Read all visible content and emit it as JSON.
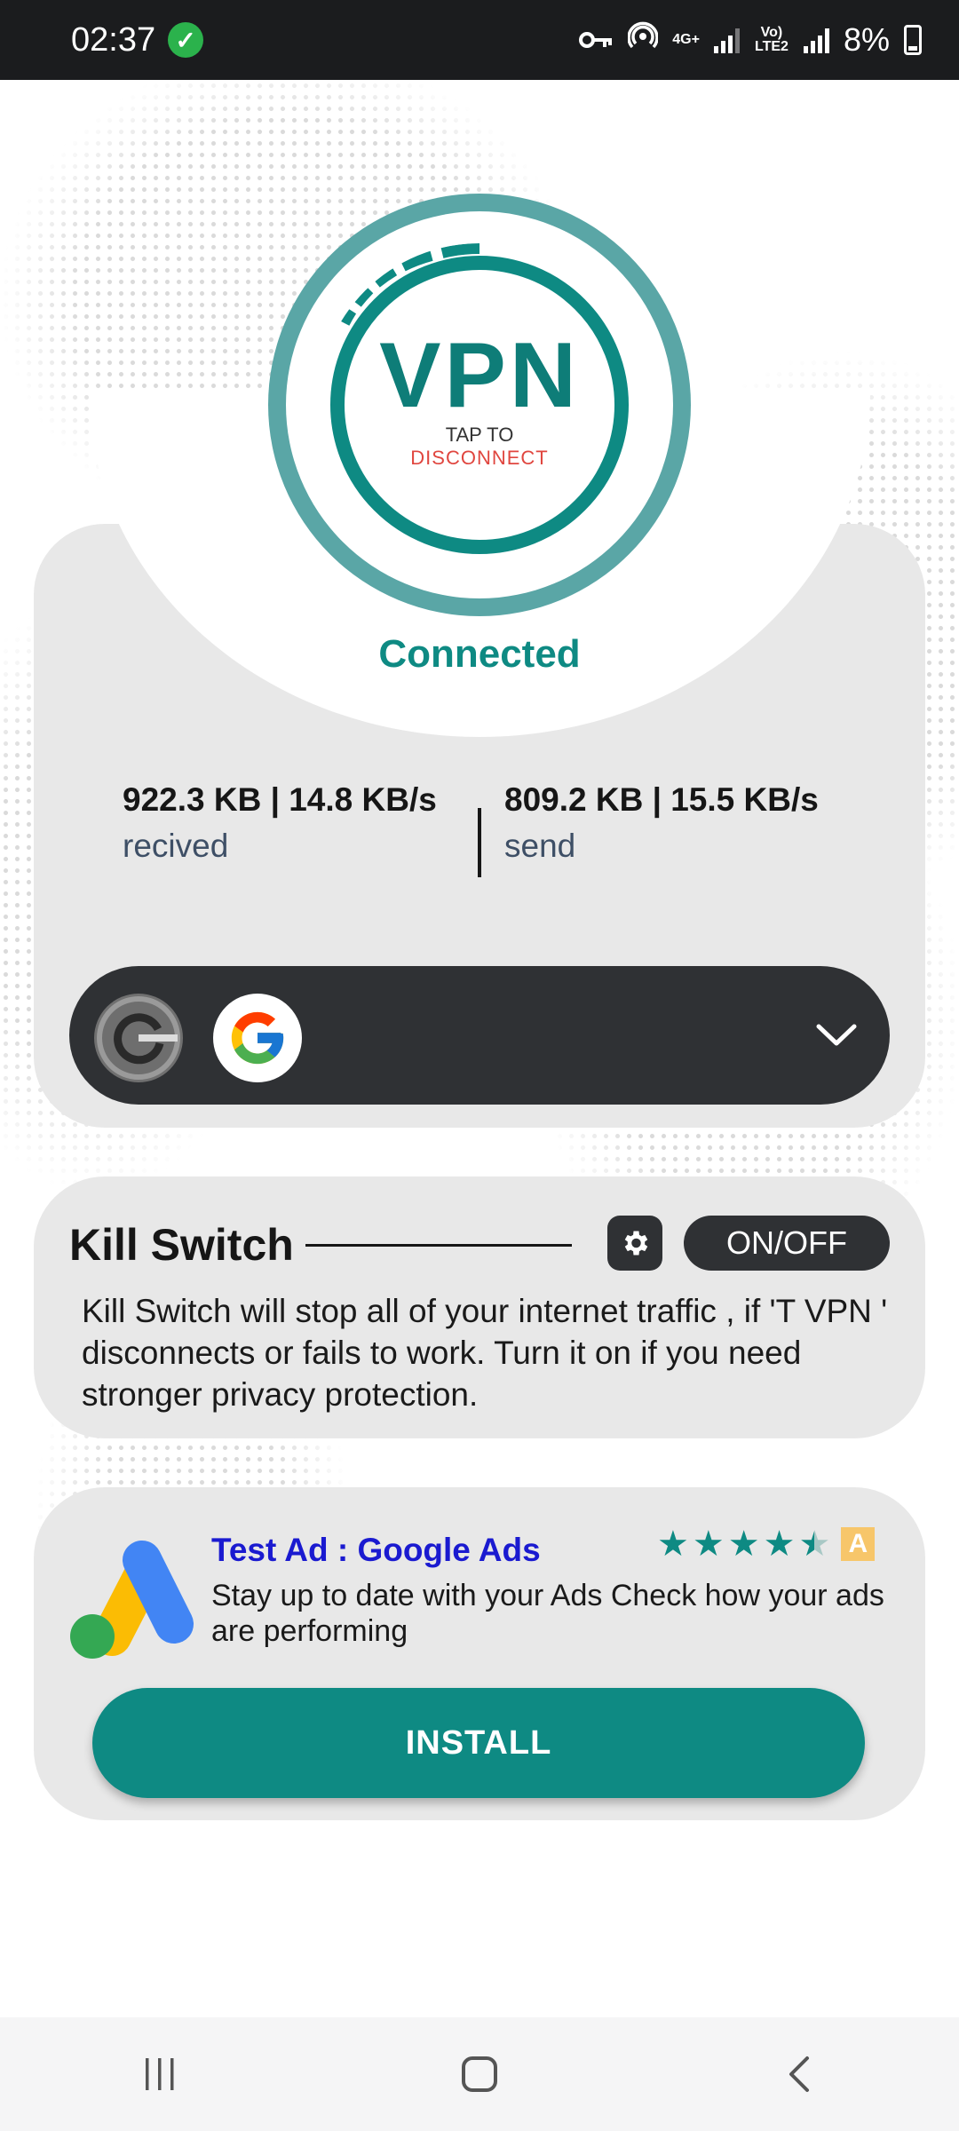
{
  "status_bar": {
    "time": "02:37",
    "battery": "8%",
    "network_4g": "4G+",
    "network_volte": "Vo) LTE2"
  },
  "vpn": {
    "logo_text": "VPN",
    "tap_to": "TAP TO",
    "action": "DISCONNECT",
    "status": "Connected"
  },
  "stats": {
    "received_value": "922.3 KB | 14.8 KB/s",
    "received_label": "recived",
    "send_value": "809.2 KB | 15.5 KB/s",
    "send_label": "send"
  },
  "kill_switch": {
    "title": "Kill Switch",
    "toggle_label": "ON/OFF",
    "description": "Kill Switch will stop all of your internet traffic , if 'T VPN ' disconnects or fails to work. Turn it on if you need stronger privacy protection."
  },
  "ad": {
    "title": "Test Ad : Google Ads",
    "description": "Stay up to date with your Ads Check how your ads are performing",
    "rating": 4.5,
    "badge": "A",
    "install_label": "INSTALL"
  },
  "colors": {
    "accent": "#0e8a83",
    "ring": "#5aa6a6",
    "card": "#e8e8e8",
    "dark": "#2f3134",
    "ad_title": "#1a1ad0"
  }
}
